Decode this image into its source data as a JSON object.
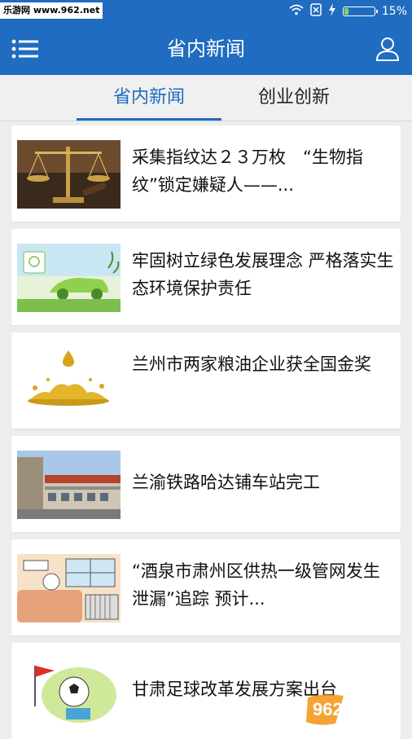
{
  "status_bar": {
    "watermark": "乐游网 www.962.net",
    "battery_text": "15%",
    "battery_level": 0.15
  },
  "header": {
    "title": "省内新闻",
    "menu_icon": "menu-icon",
    "user_icon": "user-icon"
  },
  "tabs": [
    {
      "label": "省内新闻",
      "active": true
    },
    {
      "label": "创业创新",
      "active": false
    }
  ],
  "news": [
    {
      "headline": "采集指纹达２３万枚　“生物指纹”锁定嫌疑人——...",
      "image": "scales-of-justice-image"
    },
    {
      "headline": "牢固树立绿色发展理念 严格落实生态环境保护责任",
      "image": "green-car-cartoon-image"
    },
    {
      "headline": "兰州市两家粮油企业获全国金奖",
      "image": "golden-oil-splash-image"
    },
    {
      "headline": "兰渝铁路哈达铺车站完工",
      "image": "railway-station-image"
    },
    {
      "headline": "“酒泉市肃州区供热一级管网发生泄漏”追踪 预计...",
      "image": "heating-cartoon-image"
    },
    {
      "headline": "甘肃足球改革发展方案出台",
      "image": "football-cartoon-image"
    }
  ],
  "watermark_logo": {
    "brand": "962.NET",
    "caption": "乐游网"
  },
  "colors": {
    "primary": "#1f6cc0",
    "background": "#ededed",
    "card": "#ffffff"
  }
}
